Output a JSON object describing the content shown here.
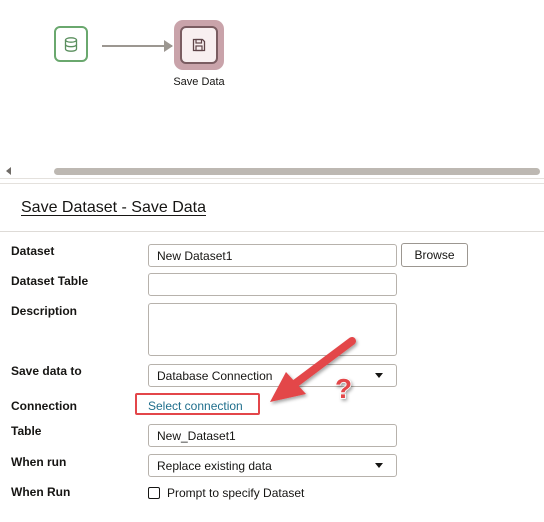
{
  "canvas": {
    "source_node": {
      "icon": "database-icon"
    },
    "save_node": {
      "icon": "floppy-disk-icon",
      "label": "Save Data"
    }
  },
  "panel": {
    "title": "Save Dataset - Save Data",
    "fields": {
      "dataset": {
        "label": "Dataset",
        "value": "New Dataset1",
        "browse_label": "Browse"
      },
      "dataset_table": {
        "label": "Dataset Table",
        "value": ""
      },
      "description": {
        "label": "Description",
        "value": ""
      },
      "save_data_to": {
        "label": "Save data to",
        "value": "Database Connection"
      },
      "connection": {
        "label": "Connection",
        "link_text": "Select connection"
      },
      "table": {
        "label": "Table",
        "value": "New_Dataset1"
      },
      "when_run": {
        "label": "When run",
        "value": "Replace existing data"
      },
      "when_run_prompt": {
        "label": "When Run",
        "checkbox_label": "Prompt to specify Dataset",
        "checked": false
      }
    }
  },
  "annotation": {
    "glyph": "?",
    "color": "#e3464a"
  }
}
